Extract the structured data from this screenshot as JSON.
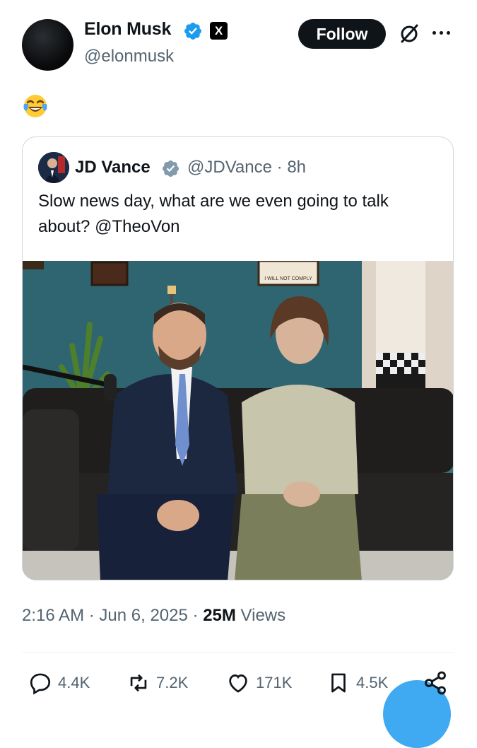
{
  "author": {
    "name": "Elon Musk",
    "handle": "@elonmusk",
    "follow_label": "Follow",
    "x_badge": "X"
  },
  "post": {
    "emoji": "face-with-tears-of-joy"
  },
  "quoted": {
    "name": "JD Vance",
    "handle": "@JDVance",
    "separator": "·",
    "time": "8h",
    "text": "Slow news day, what are we even going to talk about? @TheoVon",
    "photo_sign": "I WILL NOT COMPLY"
  },
  "meta": {
    "time": "2:16 AM",
    "date": "Jun 6, 2025",
    "views_count": "25M",
    "views_label": "Views",
    "sep": "·"
  },
  "actions": {
    "replies": "4.4K",
    "reposts": "7.2K",
    "likes": "171K",
    "bookmarks": "4.5K"
  },
  "colors": {
    "verified": "#1d9bf0",
    "quote_verified": "#829aab",
    "muted": "#536471"
  }
}
